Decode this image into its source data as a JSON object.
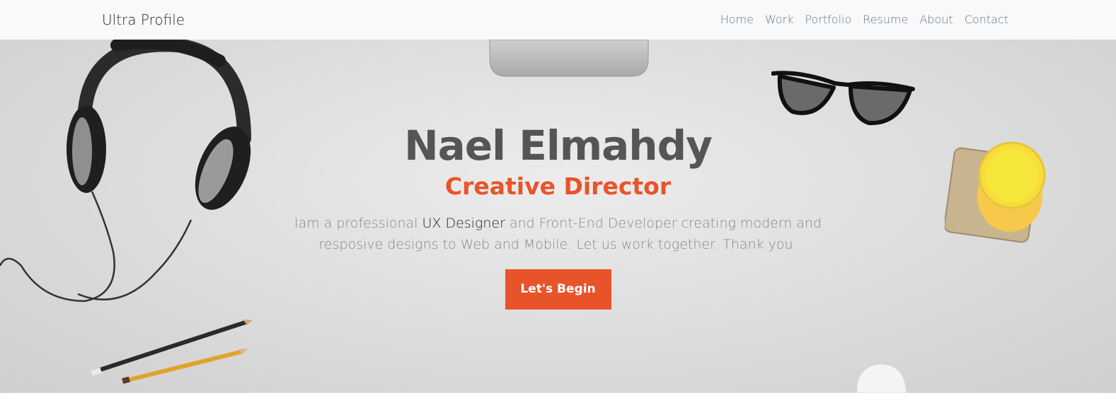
{
  "navbar": {
    "brand": "Ultra Profile",
    "links": [
      "Home",
      "Work",
      "Portfolio",
      "Resume",
      "About",
      "Contact"
    ]
  },
  "hero": {
    "name": "Nael Elmahdy",
    "role": "Creative Director",
    "desc_before": "Iam a professional ",
    "desc_highlight": "UX Designer",
    "desc_after": " and Front-End Developer creating modern and resposive designs to Web and Mobile. Let us work together. Thank you.",
    "cta_label": "Let's Begin"
  },
  "colors": {
    "accent": "#e8542a",
    "navbar_bg": "#f8f9fa",
    "name_text": "#555555"
  }
}
